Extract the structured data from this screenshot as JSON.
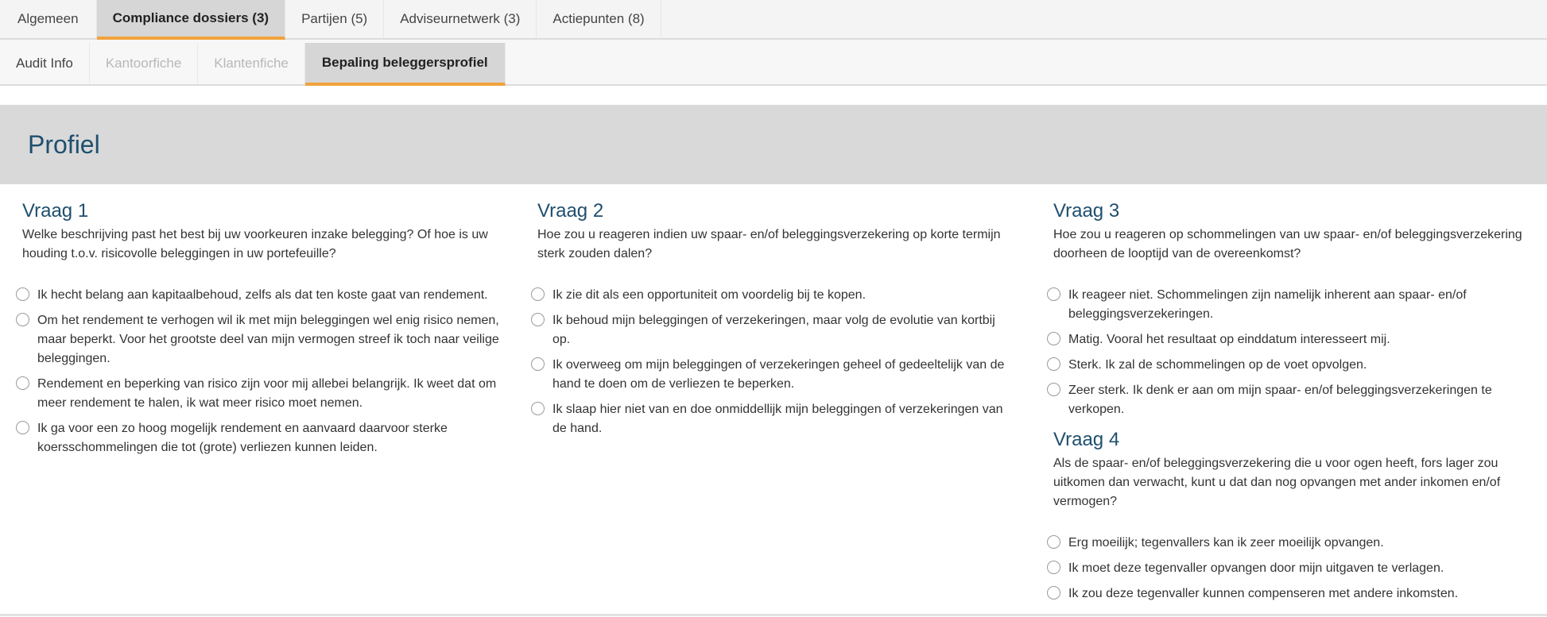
{
  "tabs_top": [
    {
      "label": "Algemeen",
      "active": false
    },
    {
      "label": "Compliance dossiers (3)",
      "active": true
    },
    {
      "label": "Partijen (5)",
      "active": false
    },
    {
      "label": "Adviseurnetwerk (3)",
      "active": false
    },
    {
      "label": "Actiepunten (8)",
      "active": false
    }
  ],
  "tabs_sub": [
    {
      "label": "Audit Info",
      "state": "normal"
    },
    {
      "label": "Kantoorfiche",
      "state": "disabled"
    },
    {
      "label": "Klantenfiche",
      "state": "disabled"
    },
    {
      "label": "Bepaling beleggersprofiel",
      "state": "active"
    }
  ],
  "profile": {
    "title": "Profiel"
  },
  "questions": [
    {
      "title": "Vraag 1",
      "text": "Welke beschrijving past het best bij uw voorkeuren inzake belegging? Of hoe is uw houding t.o.v. risicovolle beleggingen in uw portefeuille?",
      "options": [
        "Ik hecht belang aan kapitaalbehoud, zelfs als dat ten koste gaat van rendement.",
        "Om het rendement te verhogen wil ik met mijn beleggingen wel enig risico nemen, maar beperkt. Voor het grootste deel van mijn vermogen streef ik toch naar veilige beleggingen.",
        "Rendement en beperking van risico zijn voor mij allebei belangrijk. Ik weet dat om meer rendement te halen, ik wat meer risico moet nemen.",
        "Ik ga voor een zo hoog mogelijk rendement en aanvaard daarvoor sterke koersschommelingen die tot (grote) verliezen kunnen leiden."
      ]
    },
    {
      "title": "Vraag 2",
      "text": "Hoe zou u reageren indien uw spaar- en/of beleggingsverzekering op korte termijn sterk zouden dalen?",
      "options": [
        "Ik zie dit als een opportuniteit om voordelig bij te kopen.",
        "Ik behoud mijn beleggingen of verzekeringen, maar volg de evolutie van kortbij op.",
        "Ik overweeg om mijn beleggingen of verzekeringen geheel of gedeeltelijk van de hand te doen om de verliezen te beperken.",
        "Ik slaap hier niet van en doe onmiddellijk mijn beleggingen of verzekeringen van de hand."
      ]
    },
    {
      "title": "Vraag 3",
      "text": "Hoe zou u reageren op schommelingen van uw spaar- en/of beleggingsverzekering doorheen de looptijd van de overeenkomst?",
      "options": [
        "Ik reageer niet. Schommelingen zijn namelijk inherent aan spaar- en/of beleggingsverzekeringen.",
        "Matig. Vooral het resultaat op einddatum interesseert mij.",
        "Sterk. Ik zal de schommelingen op de voet opvolgen.",
        "Zeer sterk. Ik denk er aan om mijn spaar- en/of beleggingsverzekeringen te verkopen."
      ]
    },
    {
      "title": "Vraag 4",
      "text": "Als de spaar- en/of beleggingsverzekering die u voor ogen heeft, fors lager zou uitkomen dan verwacht, kunt u dat dan nog opvangen met ander inkomen en/of vermogen?",
      "options": [
        "Erg moeilijk; tegenvallers kan ik zeer moeilijk opvangen.",
        "Ik moet deze tegenvaller opvangen door mijn uitgaven te verlagen.",
        "Ik zou deze tegenvaller kunnen compenseren met andere inkomsten."
      ]
    }
  ]
}
